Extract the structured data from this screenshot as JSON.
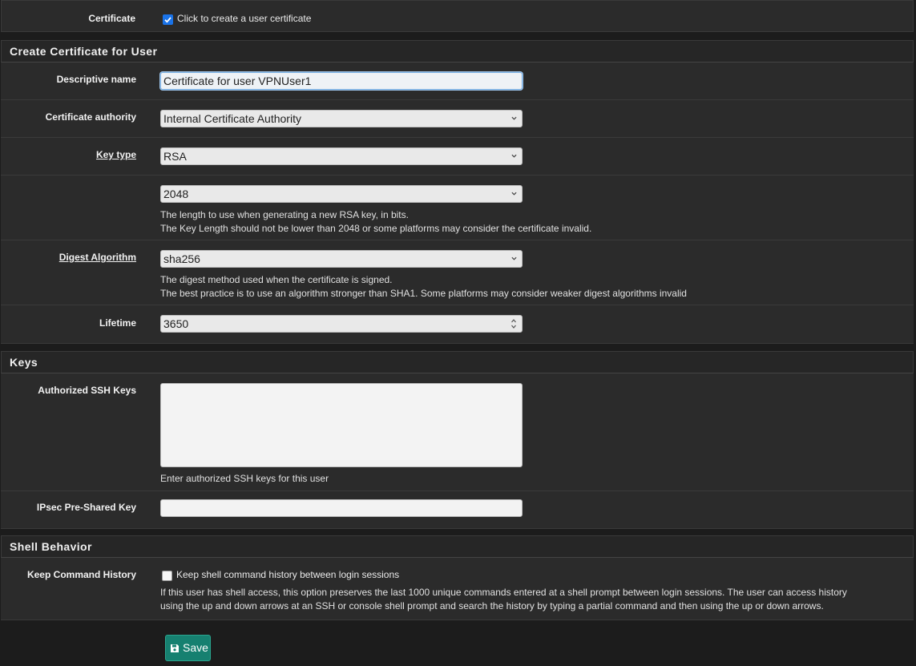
{
  "certificate_row": {
    "label": "Certificate",
    "checkbox_text": "Click to create a user certificate",
    "checked": true
  },
  "sections": {
    "create_cert": "Create Certificate for User",
    "keys": "Keys",
    "shell": "Shell Behavior"
  },
  "create_cert": {
    "descriptive_name": {
      "label": "Descriptive name",
      "value": "Certificate for user VPNUser1"
    },
    "cert_authority": {
      "label": "Certificate authority",
      "value": "Internal Certificate Authority"
    },
    "key_type": {
      "label": "Key type",
      "value": "RSA"
    },
    "key_length": {
      "value": "2048",
      "help1": "The length to use when generating a new RSA key, in bits.",
      "help2": "The Key Length should not be lower than 2048 or some platforms may consider the certificate invalid."
    },
    "digest": {
      "label": "Digest Algorithm",
      "value": "sha256",
      "help1": "The digest method used when the certificate is signed.",
      "help2": "The best practice is to use an algorithm stronger than SHA1. Some platforms may consider weaker digest algorithms invalid"
    },
    "lifetime": {
      "label": "Lifetime",
      "value": "3650"
    }
  },
  "keys": {
    "ssh": {
      "label": "Authorized SSH Keys",
      "value": "",
      "help": "Enter authorized SSH keys for this user"
    },
    "ipsec": {
      "label": "IPsec Pre-Shared Key",
      "value": ""
    }
  },
  "shell": {
    "history": {
      "label": "Keep Command History",
      "checkbox_text": "Keep shell command history between login sessions",
      "checked": false,
      "help1": "If this user has shell access, this option preserves the last 1000 unique commands entered at a shell prompt between login sessions. The user can access history",
      "help2": "using the up and down arrows at an SSH or console shell prompt and search the history by typing a partial command and then using the up or down arrows."
    }
  },
  "save_button": "Save",
  "colors": {
    "checkbox_checked": "#1a73e8",
    "save_button": "#168070"
  },
  "icons": {
    "select": "chevron-down-icon",
    "save": "floppy-disk-icon"
  }
}
